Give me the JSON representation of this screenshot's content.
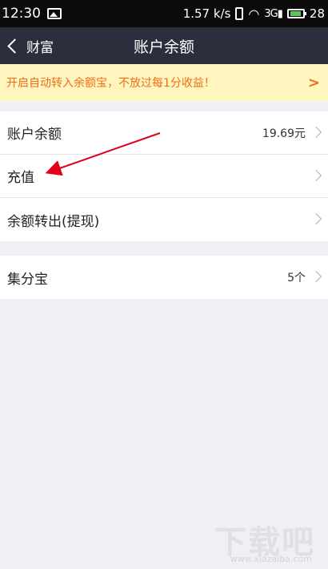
{
  "status_bar": {
    "time": "12:30",
    "speed": "1.57 k/s",
    "signal_label": "3G",
    "battery": "28"
  },
  "nav": {
    "back_label": "财富",
    "title": "账户余额"
  },
  "banner": {
    "text": "开启自动转入余额宝，不放过每1分收益！",
    "chevron": ">"
  },
  "group1": [
    {
      "label": "账户余额",
      "value": "19.69元"
    },
    {
      "label": "充值",
      "value": ""
    },
    {
      "label": "余额转出(提现)",
      "value": ""
    }
  ],
  "group2": [
    {
      "label": "集分宝",
      "value": "5个"
    }
  ],
  "watermark": {
    "text": "下载吧",
    "url": "www.xiazaiba.com"
  },
  "colors": {
    "nav_bg": "#2c2e3d",
    "banner_bg": "#fff5bf",
    "banner_text": "#f06e1a",
    "annotation_arrow": "#e3001b"
  }
}
